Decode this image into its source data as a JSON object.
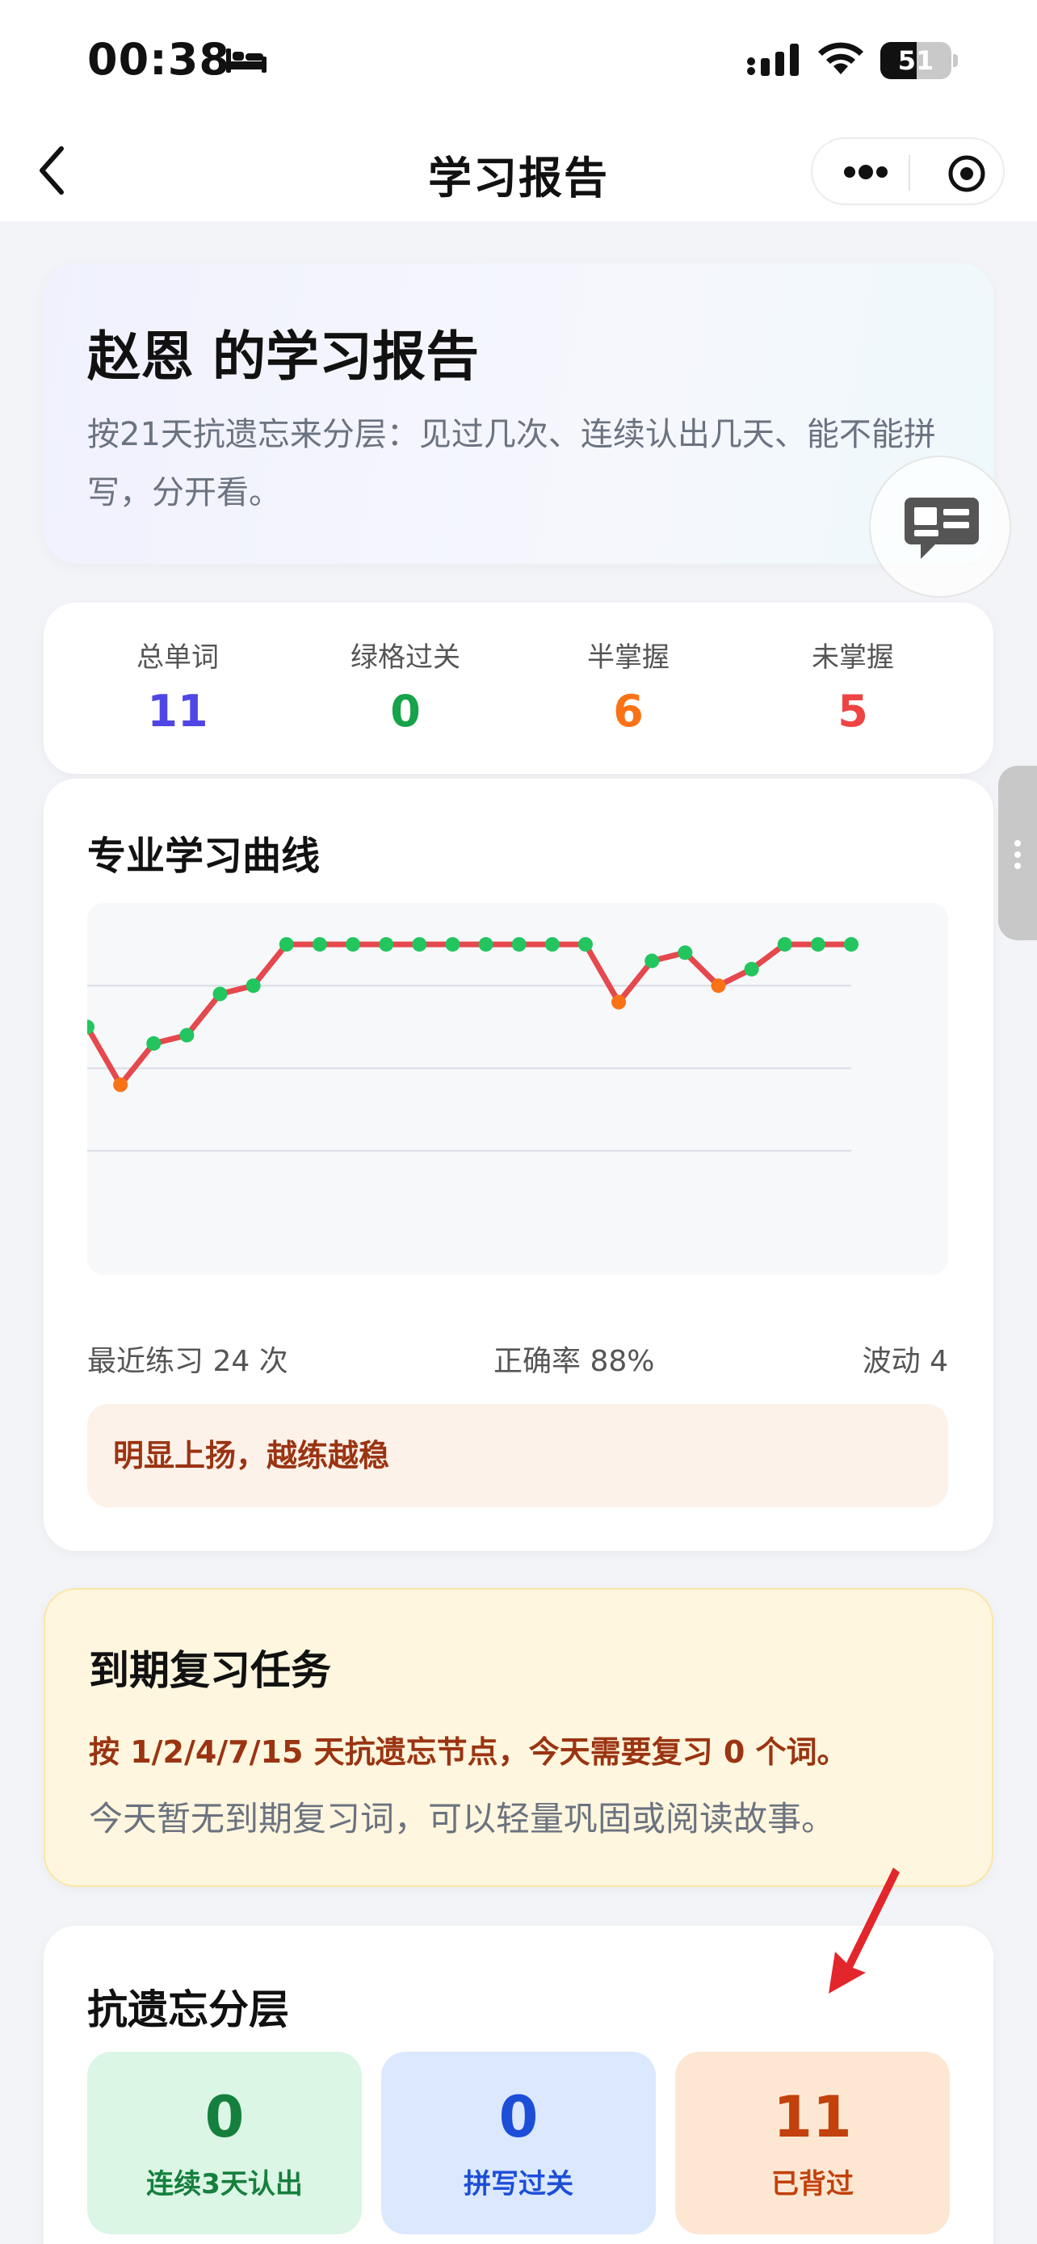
{
  "status_bar": {
    "time": "00:38",
    "battery": "51",
    "battery_level": 0.51
  },
  "nav": {
    "title": "学习报告"
  },
  "hero": {
    "title": "赵恩 的学习报告",
    "subtitle": "按21天抗遗忘来分层：见过几次、连续认出几天、能不能拼写，分开看。"
  },
  "stats": [
    {
      "label": "总单词",
      "value": "11",
      "color": "#4f46e5"
    },
    {
      "label": "绿格过关",
      "value": "0",
      "color": "#16a34a"
    },
    {
      "label": "半掌握",
      "value": "6",
      "color": "#f97316"
    },
    {
      "label": "未掌握",
      "value": "5",
      "color": "#ef4444"
    }
  ],
  "curve": {
    "title": "专业学习曲线",
    "recent": "最近练习 24 次",
    "accuracy": "正确率 88%",
    "volatility": "波动 4",
    "note": "明显上扬，越练越稳"
  },
  "chart_data": {
    "type": "line",
    "x": [
      1,
      2,
      3,
      4,
      5,
      6,
      7,
      8,
      9,
      10,
      11,
      12,
      13,
      14,
      15,
      16,
      17,
      18,
      19,
      20,
      21,
      22,
      23,
      24
    ],
    "values": [
      75,
      68,
      73,
      74,
      79,
      80,
      85,
      85,
      85,
      85,
      85,
      85,
      85,
      85,
      85,
      85,
      78,
      83,
      84,
      80,
      82,
      85,
      85,
      85
    ],
    "point_status": [
      "g",
      "o",
      "g",
      "g",
      "g",
      "g",
      "g",
      "g",
      "g",
      "g",
      "g",
      "g",
      "g",
      "g",
      "g",
      "g",
      "o",
      "g",
      "g",
      "o",
      "g",
      "g",
      "g",
      "g"
    ],
    "ylim": [
      45,
      90
    ],
    "gridlines": [
      80,
      70,
      60
    ],
    "grid": true,
    "colors": {
      "line": "#e5484d",
      "good": "#22c55e",
      "warn": "#f97316"
    }
  },
  "review": {
    "title": "到期复习任务",
    "bold_line": "按 1/2/4/7/15 天抗遗忘节点，今天需要复习 0 个词。",
    "sub_line": "今天暂无到期复习词，可以轻量巩固或阅读故事。"
  },
  "layers": {
    "title": "抗遗忘分层",
    "tiles": [
      {
        "value": "0",
        "label": "连续3天认出",
        "bg": "#dcf6e6",
        "color": "#15803d"
      },
      {
        "value": "0",
        "label": "拼写过关",
        "bg": "#dbe8fd",
        "color": "#1d4ed8"
      },
      {
        "value": "11",
        "label": "已背过",
        "bg": "#fde7d3",
        "color": "#c2410c"
      }
    ]
  }
}
